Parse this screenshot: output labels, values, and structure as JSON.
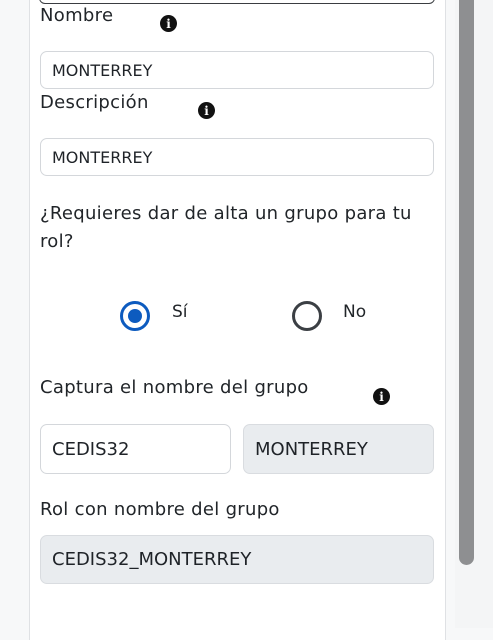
{
  "form": {
    "nombre": {
      "label": "Nombre",
      "value": "MONTERREY"
    },
    "descripcion": {
      "label": "Descripción",
      "value": "MONTERREY"
    },
    "question": "¿Requieres dar de alta un grupo para tu rol?",
    "radio": {
      "yes_label": "Sí",
      "no_label": "No",
      "selected": "Sí"
    },
    "grupo": {
      "label": "Captura el nombre del grupo",
      "value": "CEDIS32",
      "suffix_value": "MONTERREY"
    },
    "rol_grupo": {
      "label": "Rol con nombre del grupo",
      "value": "CEDIS32_MONTERREY"
    }
  },
  "icons": {
    "info": "info-icon",
    "info_glyph": "i"
  },
  "colors": {
    "accent": "#0d5bbf",
    "disabled_bg": "#e9ecef",
    "border": "#d4d7db"
  }
}
